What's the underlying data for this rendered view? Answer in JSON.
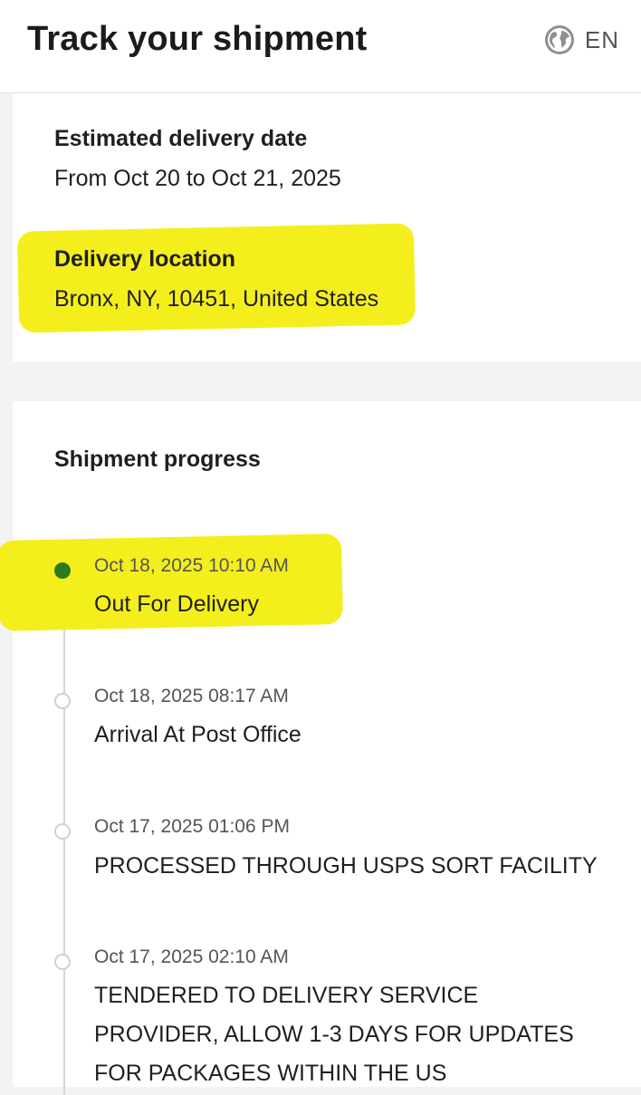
{
  "header": {
    "title": "Track your shipment",
    "language": "EN",
    "language_icon": "globe-icon"
  },
  "delivery": {
    "estimated_label": "Estimated delivery date",
    "estimated_value": "From Oct 20 to Oct 21, 2025",
    "location_label": "Delivery location",
    "location_value": "Bronx, NY, 10451, United States"
  },
  "progress": {
    "title": "Shipment progress",
    "events": [
      {
        "time": "Oct 18, 2025 10:10 AM",
        "status": "Out For Delivery",
        "active": true
      },
      {
        "time": "Oct 18, 2025 08:17 AM",
        "status": "Arrival At Post Office",
        "active": false
      },
      {
        "time": "Oct 17, 2025 01:06 PM",
        "status": "PROCESSED THROUGH USPS SORT FACILITY",
        "active": false
      },
      {
        "time": "Oct 17, 2025 02:10 AM",
        "status_lines": [
          "TENDERED TO DELIVERY SERVICE",
          "PROVIDER, ALLOW 1-3 DAYS FOR UPDATES",
          "FOR PACKAGES WITHIN THE US"
        ],
        "active": false
      }
    ]
  },
  "colors": {
    "highlight": "#f4ef1c",
    "active_dot": "#2c7a1e",
    "inactive_dot_border": "#d0d0d0"
  }
}
